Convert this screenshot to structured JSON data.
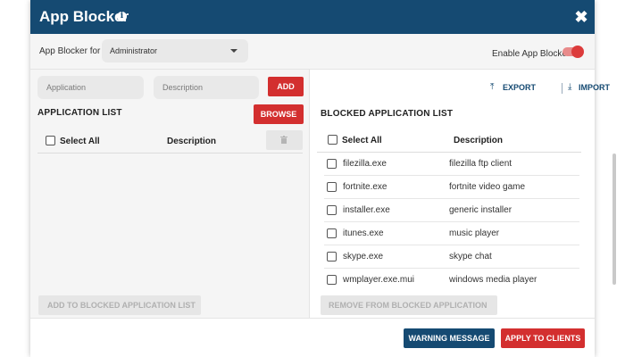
{
  "window": {
    "title": "App Blocker",
    "info_icon": "info-icon",
    "close_icon": "close-icon"
  },
  "topbar": {
    "for_label": "App Blocker for",
    "selected_user": "Administrator",
    "enable_label": "Enable App Blocker",
    "enabled": true
  },
  "left": {
    "app_placeholder": "Application",
    "desc_placeholder": "Description",
    "add_label": "ADD",
    "browse_label": "BROWSE",
    "list_title": "APPLICATION LIST",
    "select_all": "Select All",
    "desc_header": "Description",
    "delete_icon": "trash-icon",
    "add_to_blocked_label": "ADD TO BLOCKED APPLICATION LIST"
  },
  "right": {
    "export_label": "EXPORT",
    "import_label": "IMPORT",
    "list_title": "BLOCKED APPLICATION LIST",
    "select_all": "Select All",
    "desc_header": "Description",
    "rows": [
      {
        "app": "filezilla.exe",
        "desc": "filezilla ftp client"
      },
      {
        "app": "fortnite.exe",
        "desc": "fortnite video game"
      },
      {
        "app": "installer.exe",
        "desc": "generic installer"
      },
      {
        "app": "itunes.exe",
        "desc": "music player"
      },
      {
        "app": "skype.exe",
        "desc": "skype chat"
      },
      {
        "app": "wmplayer.exe.mui",
        "desc": "windows media player"
      }
    ],
    "remove_label": "REMOVE FROM BLOCKED APPLICATION LIST"
  },
  "footer": {
    "warning_label": "WARNING MESSAGE",
    "apply_label": "APPLY TO CLIENTS"
  },
  "colors": {
    "header": "#154a72",
    "accent_red": "#d32f2f",
    "toggle_on": "#dc3b3b"
  }
}
